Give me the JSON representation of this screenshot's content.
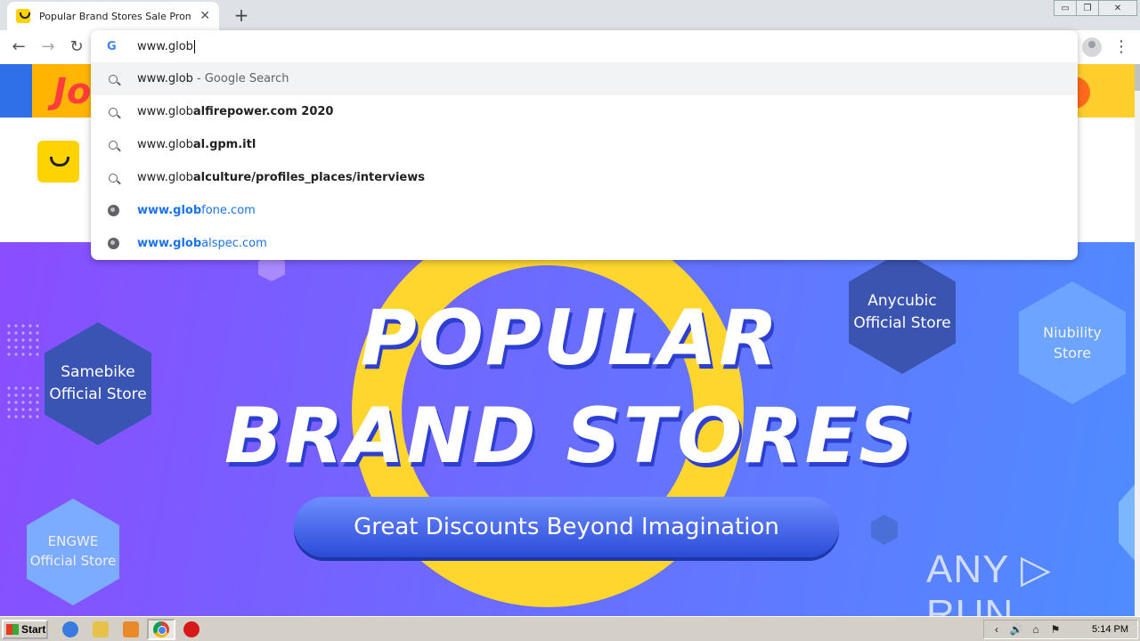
{
  "browser": {
    "tab_title": "Popular Brand Stores Sale Promotion",
    "tab_close": "✕",
    "new_tab": "+",
    "back": "←",
    "forward": "→",
    "reload": "↻",
    "menu": "⋮",
    "window_controls": {
      "minimize": "▭",
      "maximize": "❐",
      "close": "✕"
    }
  },
  "omnibox": {
    "typed_text": "www.glob",
    "suggestions": [
      {
        "kind": "search",
        "typed": "www.glob",
        "rest": "",
        "suffix": " - Google Search"
      },
      {
        "kind": "search",
        "typed": "www.glob",
        "rest": "alfirepower.com 2020",
        "suffix": ""
      },
      {
        "kind": "search",
        "typed": "www.glob",
        "rest": "al.gpm.itl",
        "suffix": ""
      },
      {
        "kind": "search",
        "typed": "www.glob",
        "rest": "alculture/profiles_places/interviews",
        "suffix": ""
      },
      {
        "kind": "url",
        "typed": "www.glob",
        "rest": "fone.com",
        "suffix": ""
      },
      {
        "kind": "url",
        "typed": "www.glob",
        "rest": "alspec.com",
        "suffix": ""
      }
    ]
  },
  "page": {
    "strip_text": "Jo",
    "hero": {
      "line1": "POPULAR",
      "line2": "BRAND STORES",
      "tagline": "Great Discounts Beyond Imagination",
      "stores": {
        "samebike": "Samebike\nOfficial Store",
        "anycubic": "Anycubic\nOfficial Store",
        "niubility": "Niubility\nStore",
        "engwe": "ENGWE\nOfficial Store"
      }
    },
    "watermark": "ANY ▷ RUN"
  },
  "taskbar": {
    "start_label": "Start",
    "clock": "5:14 PM",
    "tray_icons": [
      "‹",
      "🔊",
      "⌂",
      "⚑"
    ]
  },
  "colors": {
    "tab_strip": "#dee1e6",
    "accent_blue": "#1a73e8",
    "hero_purple": "#8a4dff",
    "hero_yellow": "#ffd62e",
    "brand_yellow": "#ffd300"
  }
}
